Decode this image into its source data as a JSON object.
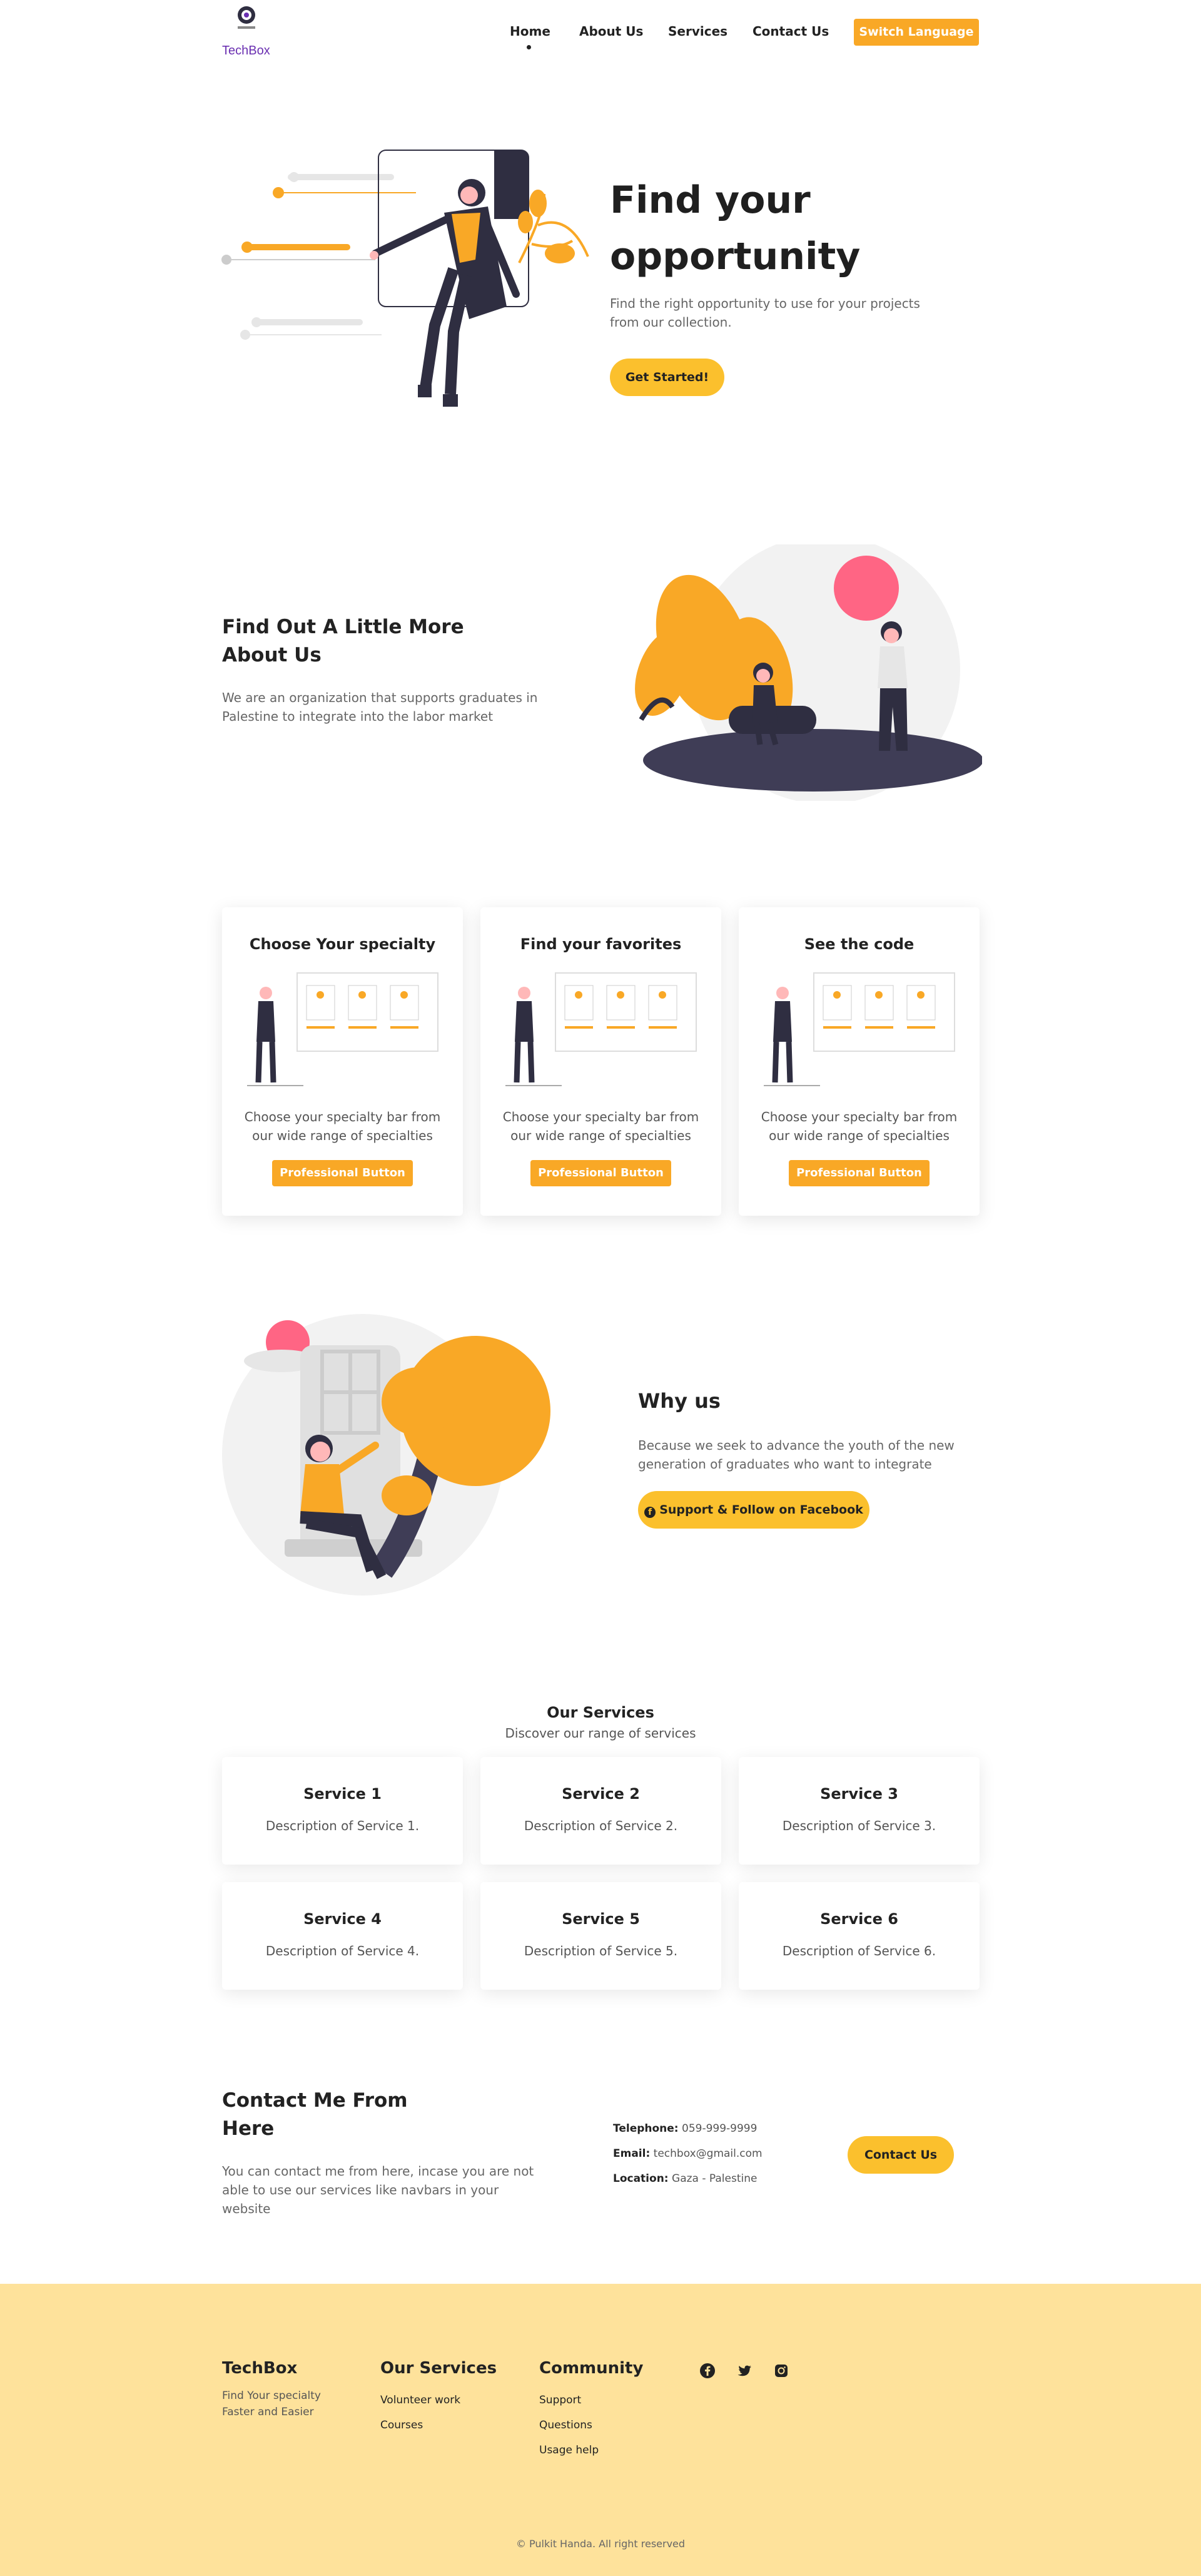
{
  "brand": {
    "name": "TechBox",
    "logo_caption": "TechBox"
  },
  "nav": {
    "items": [
      {
        "label": "Home"
      },
      {
        "label": "About Us"
      },
      {
        "label": "Services"
      },
      {
        "label": "Contact Us"
      }
    ],
    "active": "Home",
    "switch_language": "Switch Language"
  },
  "hero": {
    "title_line1": "Find your",
    "title_line2": "opportunity",
    "subtitle": "Find the right opportunity to use for your projects from our collection.",
    "cta": "Get Started!"
  },
  "about": {
    "title_line1": "Find Out A Little More",
    "title_line2": "About Us",
    "text": "We are an organization that supports graduates in Palestine to integrate into the labor market"
  },
  "cards": [
    {
      "title": "Choose Your specialty",
      "text": "Choose your specialty bar from our wide range of specialties",
      "button": "Professional Button"
    },
    {
      "title": "Find your favorites",
      "text": "Choose your specialty bar from our wide range of specialties",
      "button": "Professional Button"
    },
    {
      "title": "See the code",
      "text": "Choose your specialty bar from our wide range of specialties",
      "button": "Professional Button"
    }
  ],
  "why": {
    "title": "Why us",
    "text": "Because we seek to advance the youth of the new generation of graduates who want to integrate",
    "button": "Support & Follow on Facebook"
  },
  "services": {
    "heading": "Our Services",
    "subheading": "Discover our range of services",
    "items": [
      {
        "title": "Service 1",
        "desc": "Description of Service 1."
      },
      {
        "title": "Service 2",
        "desc": "Description of Service 2."
      },
      {
        "title": "Service 3",
        "desc": "Description of Service 3."
      },
      {
        "title": "Service 4",
        "desc": "Description of Service 4."
      },
      {
        "title": "Service 5",
        "desc": "Description of Service 5."
      },
      {
        "title": "Service 6",
        "desc": "Description of Service 6."
      }
    ]
  },
  "contact": {
    "title_line1": "Contact Me From",
    "title_line2": "Here",
    "text": "You can contact me from here, incase you are not able to use our services like navbars in your website",
    "telephone_label": "Telephone:",
    "telephone": "059-999-9999",
    "email_label": "Email:",
    "email": "techbox@gmail.com",
    "location_label": "Location:",
    "location": "Gaza - Palestine",
    "button": "Contact Us"
  },
  "footer": {
    "brand": "TechBox",
    "tagline_line1": "Find Your specialty",
    "tagline_line2": "Faster and Easier",
    "services_heading": "Our Services",
    "services_links": [
      "Volunteer work",
      "Courses"
    ],
    "community_heading": "Community",
    "community_links": [
      "Support",
      "Questions",
      "Usage help"
    ],
    "social_icons": [
      "facebook-icon",
      "twitter-icon",
      "instagram-icon"
    ],
    "copyright": "© Pulkit Handa. All right reserved"
  },
  "colors": {
    "accent": "#f9a826",
    "pill": "#fbc02d",
    "footer_bg": "#fee29b",
    "dark": "#2f2e41",
    "brand_text": "#6a2fb1",
    "pink": "#ff6584"
  }
}
